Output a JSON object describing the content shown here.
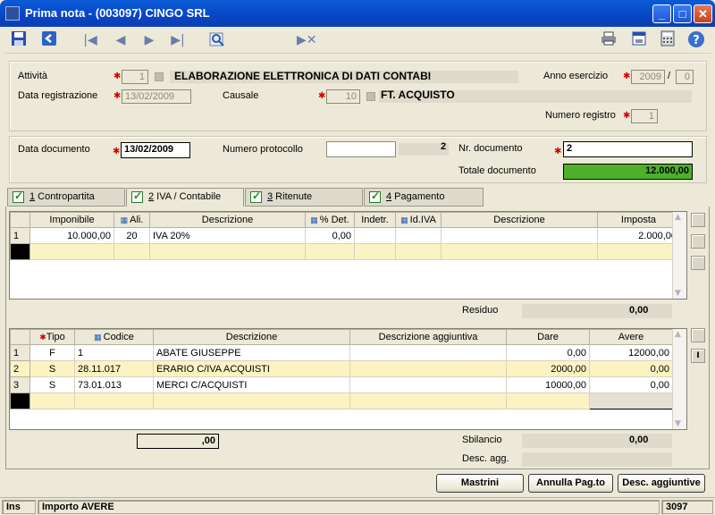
{
  "window": {
    "title": "Prima nota  -  (003097) CINGO SRL"
  },
  "header": {
    "attivita_label": "Attività",
    "attivita_code": "1",
    "attivita_desc": "ELABORAZIONE ELETTRONICA DI DATI CONTABI",
    "anno_label": "Anno esercizio",
    "anno_value": "2009",
    "anno_sep": "/",
    "anno_sub": "0",
    "data_reg_label": "Data registrazione",
    "data_reg_value": "13/02/2009",
    "causale_label": "Causale",
    "causale_code": "10",
    "causale_desc": "FT. ACQUISTO",
    "numreg_label": "Numero registro",
    "numreg_value": "1"
  },
  "document": {
    "data_doc_label": "Data documento",
    "data_doc_value": "13/02/2009",
    "protocollo_label": "Numero protocollo",
    "protocollo_value": "",
    "protocollo_num": "2",
    "nr_doc_label": "Nr. documento",
    "nr_doc_value": "2",
    "totale_label": "Totale documento",
    "totale_value": "12.000,00"
  },
  "tabs": [
    {
      "num": "1",
      "label": " Contropartita"
    },
    {
      "num": "2",
      "label": " IVA / Contabile"
    },
    {
      "num": "3",
      "label": " Ritenute"
    },
    {
      "num": "4",
      "label": " Pagamento"
    }
  ],
  "iva_grid": {
    "headers": [
      "Imponibile",
      "Ali.",
      "Descrizione",
      "% Det.",
      "Indetr.",
      "Id.IVA",
      "Descrizione",
      "Imposta"
    ],
    "rows": [
      {
        "n": "1",
        "imponibile": "10.000,00",
        "ali": "20",
        "descrizione": "IVA 20%",
        "det": "0,00",
        "indetr": "",
        "idiva": "",
        "descrizione2": "",
        "imposta": "2.000,00"
      }
    ],
    "residuo_label": "Residuo",
    "residuo_value": "0,00"
  },
  "conti_grid": {
    "headers": [
      "Tipo",
      "Codice",
      "Descrizione",
      "Descrizione aggiuntiva",
      "Dare",
      "Avere"
    ],
    "rows": [
      {
        "n": "1",
        "tipo": "F",
        "codice": "1",
        "descrizione": "ABATE GIUSEPPE",
        "agg": "",
        "dare": "0,00",
        "avere": "12000,00"
      },
      {
        "n": "2",
        "tipo": "S",
        "codice": "28.11.017",
        "descrizione": "ERARIO C/IVA ACQUISTI",
        "agg": "",
        "dare": "2000,00",
        "avere": "0,00"
      },
      {
        "n": "3",
        "tipo": "S",
        "codice": "73.01.013",
        "descrizione": "MERCI C/ACQUISTI",
        "agg": "",
        "dare": "10000,00",
        "avere": "0,00"
      }
    ],
    "total_value": ",00",
    "sbilancio_label": "Sbilancio",
    "sbilancio_value": "0,00",
    "desc_agg_label": "Desc. agg."
  },
  "buttons": {
    "mastrini": "Mastrini",
    "annulla": "Annulla Pag.to",
    "desc_agg": "Desc. aggiuntive"
  },
  "statusbar": {
    "mode": "Ins",
    "message": "Importo AVERE",
    "code": "3097"
  },
  "colors": {
    "totale_bg": "#4fb02c",
    "title_bar": "#0a5bd6",
    "new_row": "#fbf3c2"
  },
  "toolbar_icons": [
    "save-icon",
    "back-icon",
    "first-icon",
    "prev-icon",
    "next-icon",
    "last-icon",
    "search-icon",
    "clear-icon",
    "print-icon",
    "print-preview-icon",
    "calculator-icon",
    "help-icon"
  ]
}
